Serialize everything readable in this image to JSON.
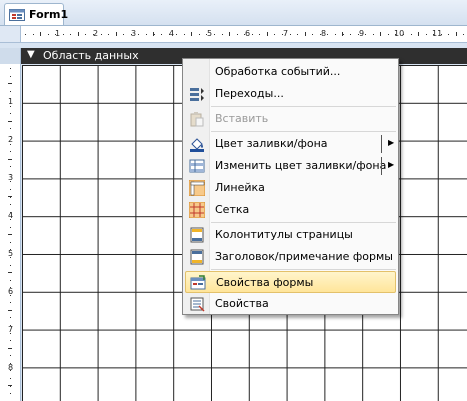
{
  "tabbar": {
    "tab_label": "Form1",
    "tab_icon": "form-icon"
  },
  "ruler": {
    "h_numbers": [
      "1",
      "2",
      "3",
      "4",
      "5",
      "6",
      "7",
      "8",
      "9",
      "10",
      "11"
    ],
    "v_numbers": [
      "1",
      "2",
      "3",
      "4",
      "5",
      "6",
      "7",
      "8"
    ]
  },
  "section": {
    "label": "Область данных",
    "icon": "triangle-down-icon"
  },
  "context_menu": {
    "items": [
      {
        "label": "Обработка событий...",
        "icon": "",
        "disabled": false
      },
      {
        "label": "Переходы...",
        "icon": "tab-order-icon",
        "disabled": false
      },
      {
        "label": "Вставить",
        "icon": "paste-icon",
        "disabled": true
      },
      {
        "label": "Цвет заливки/фона",
        "icon": "fill-color-icon",
        "disabled": false,
        "submenu": true
      },
      {
        "label": "Изменить цвет заливки/фона",
        "icon": "alternate-fill-icon",
        "disabled": false,
        "submenu": true
      },
      {
        "label": "Линейка",
        "icon": "ruler-icon",
        "disabled": false
      },
      {
        "label": "Сетка",
        "icon": "grid-icon",
        "disabled": false
      },
      {
        "label": "Колонтитулы страницы",
        "icon": "page-header-icon",
        "disabled": false
      },
      {
        "label": "Заголовок/примечание формы",
        "icon": "form-header-icon",
        "disabled": false
      },
      {
        "label": "Свойства формы",
        "icon": "form-properties-icon",
        "disabled": false,
        "highlighted": true
      },
      {
        "label": "Свойства",
        "icon": "properties-icon",
        "disabled": false
      }
    ]
  },
  "colors": {
    "highlight": "#ffe59a",
    "section_bar": "#2f2f2f",
    "grid": "#222222"
  }
}
